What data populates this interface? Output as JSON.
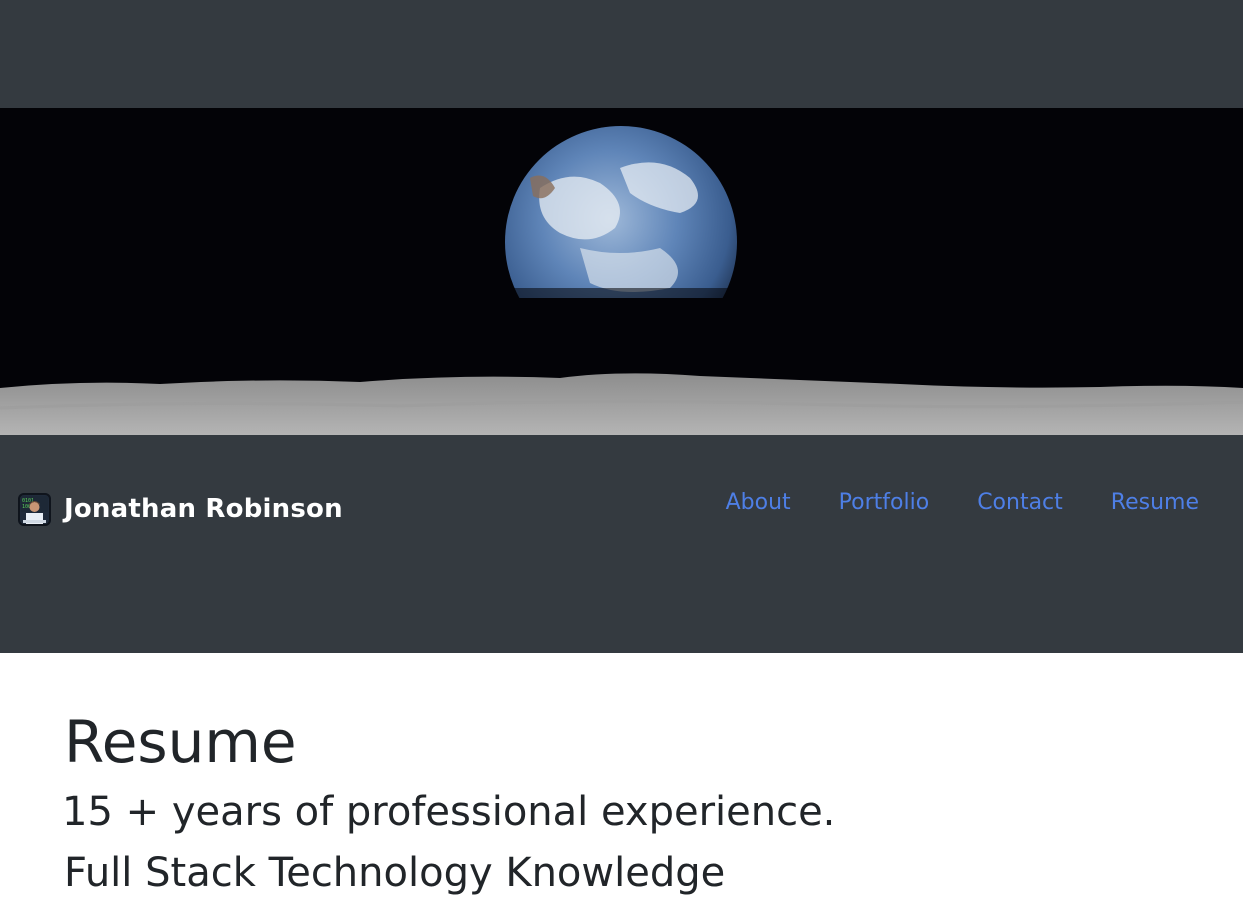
{
  "header": {
    "brand_name": "Jonathan Robinson",
    "brand_icon": "technologist-emoji-icon"
  },
  "hero": {
    "image": "earthrise-over-moon"
  },
  "nav": {
    "items": [
      {
        "label": "About"
      },
      {
        "label": "Portfolio"
      },
      {
        "label": "Contact"
      },
      {
        "label": "Resume"
      }
    ]
  },
  "main": {
    "title": "Resume",
    "experience": "15 + years of professional experience.",
    "knowledge": "Full Stack Technology Knowledge"
  },
  "colors": {
    "navbar_bg": "#343a40",
    "link": "#4e7fe6",
    "text": "#212529"
  }
}
